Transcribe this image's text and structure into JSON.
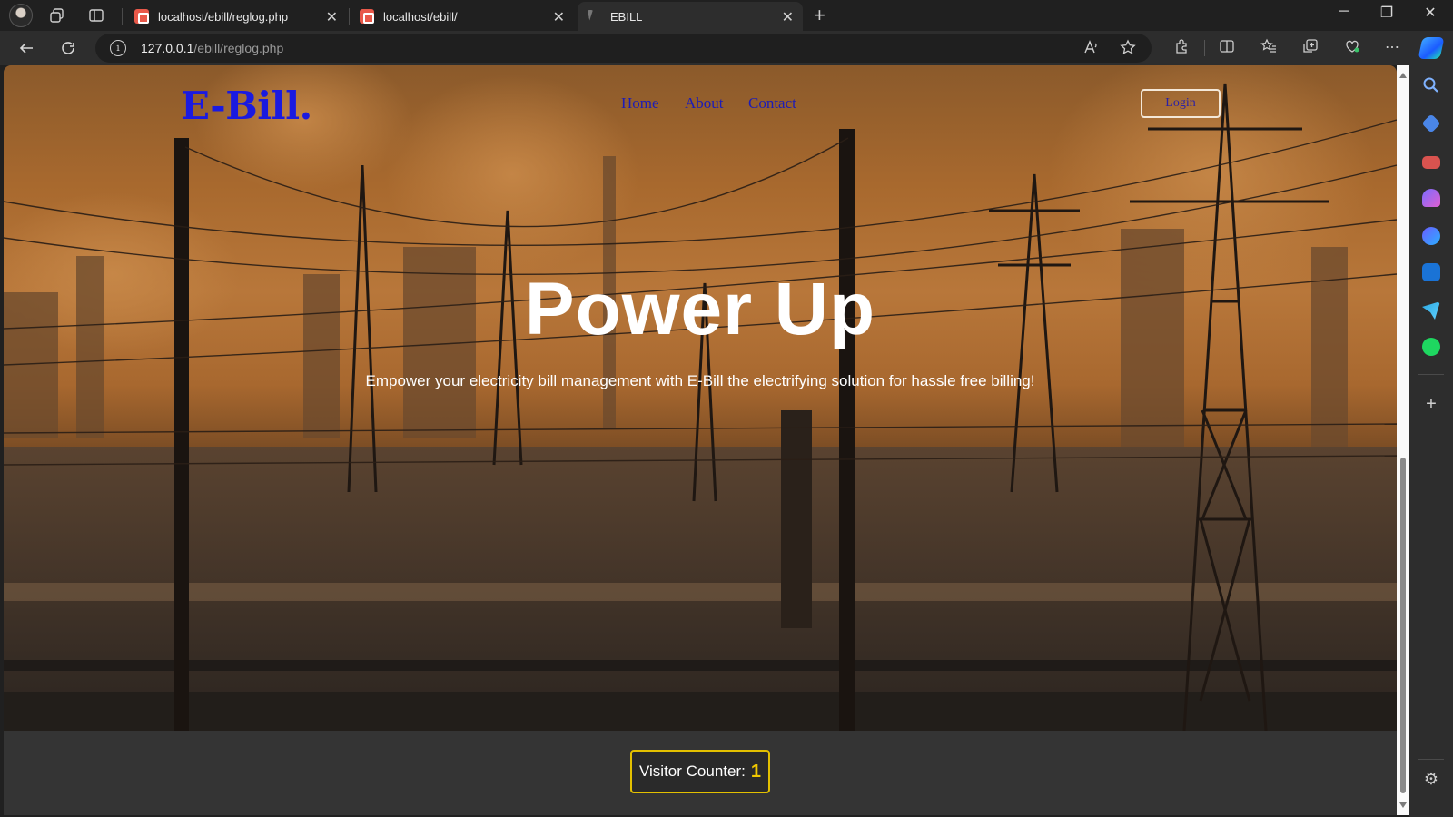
{
  "browser": {
    "tabs": [
      {
        "title": "localhost/ebill/reglog.php",
        "active": false
      },
      {
        "title": "localhost/ebill/",
        "active": false
      },
      {
        "title": "EBILL",
        "active": true
      }
    ],
    "address": {
      "host": "127.0.0.1",
      "path": "/ebill/reglog.php"
    },
    "accent": "#1a1ae0"
  },
  "site": {
    "brand": "E-Bill.",
    "nav": {
      "home": "Home",
      "about": "About",
      "contact": "Contact"
    },
    "login_label": "Login",
    "hero_title": "Power Up",
    "hero_subtitle": "Empower your electricity bill management with E-Bill the electrifying solution for hassle free billing!",
    "visitor_counter_label": "Visitor Counter:",
    "visitor_count": "1",
    "counter_border_color": "#e3c000"
  }
}
